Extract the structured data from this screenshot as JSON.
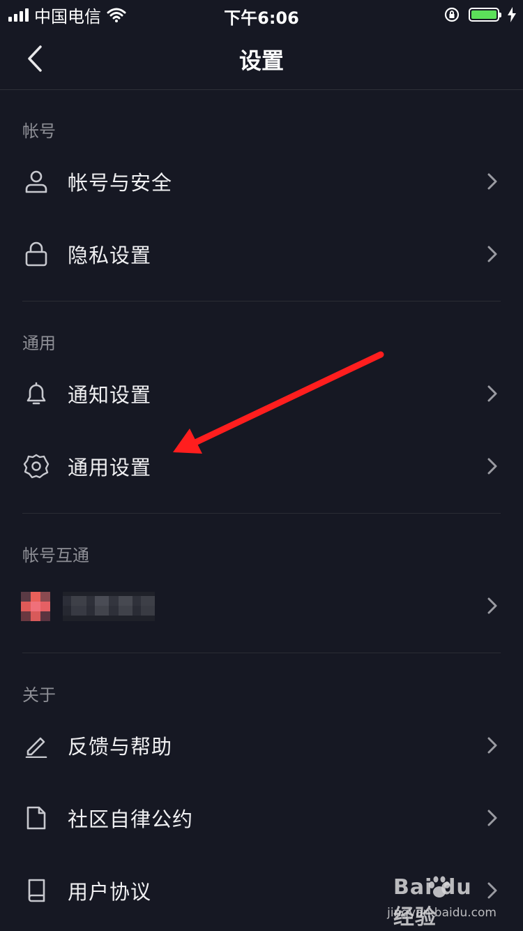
{
  "status_bar": {
    "carrier": "中国电信",
    "time": "下午6:06"
  },
  "nav": {
    "title": "设置"
  },
  "sections": {
    "account": {
      "title": "帐号",
      "items": [
        {
          "label": "帐号与安全",
          "icon": "user-icon"
        },
        {
          "label": "隐私设置",
          "icon": "lock-icon"
        }
      ]
    },
    "general": {
      "title": "通用",
      "items": [
        {
          "label": "通知设置",
          "icon": "bell-icon"
        },
        {
          "label": "通用设置",
          "icon": "gear-icon"
        }
      ]
    },
    "linked": {
      "title": "帐号互通"
    },
    "about": {
      "title": "关于",
      "items": [
        {
          "label": "反馈与帮助",
          "icon": "edit-icon"
        },
        {
          "label": "社区自律公约",
          "icon": "document-icon"
        },
        {
          "label": "用户协议",
          "icon": "book-icon"
        }
      ]
    }
  },
  "watermark": {
    "main": "Bai du 经验",
    "sub": "jingyan.baidu.com"
  },
  "colors": {
    "background": "#161823",
    "annotation_arrow": "#ff1e1e",
    "battery": "#5ce05a"
  }
}
